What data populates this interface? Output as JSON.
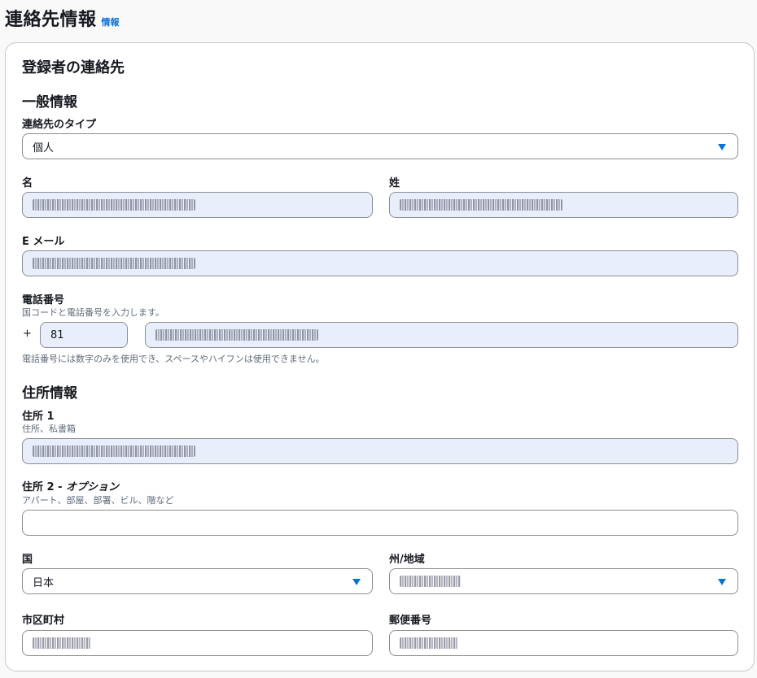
{
  "header": {
    "title": "連絡先情報",
    "info_link": "情報"
  },
  "card": {
    "title": "登録者の連絡先",
    "general_section": "一般情報",
    "address_section": "住所情報"
  },
  "fields": {
    "contact_type": {
      "label": "連絡先のタイプ",
      "value": "個人"
    },
    "first_name": {
      "label": "名"
    },
    "last_name": {
      "label": "姓"
    },
    "email": {
      "label": "E メール"
    },
    "phone": {
      "label": "電話番号",
      "description": "国コードと電話番号を入力します。",
      "plus": "+",
      "country_code": "81",
      "constraint": "電話番号には数字のみを使用でき、スペースやハイフンは使用できません。"
    },
    "address1": {
      "label": "住所 1",
      "description": "住所、私書箱"
    },
    "address2": {
      "label": "住所 2 - ",
      "label_optional": "オプション",
      "description": "アパート、部屋、部署、ビル、階など",
      "value": ""
    },
    "country": {
      "label": "国",
      "value": "日本"
    },
    "state": {
      "label": "州/地域"
    },
    "city": {
      "label": "市区町村"
    },
    "postal": {
      "label": "郵便番号"
    }
  },
  "colors": {
    "accent": "#0972d3",
    "filled_bg": "#e8effa",
    "border": "#8c8c94"
  }
}
